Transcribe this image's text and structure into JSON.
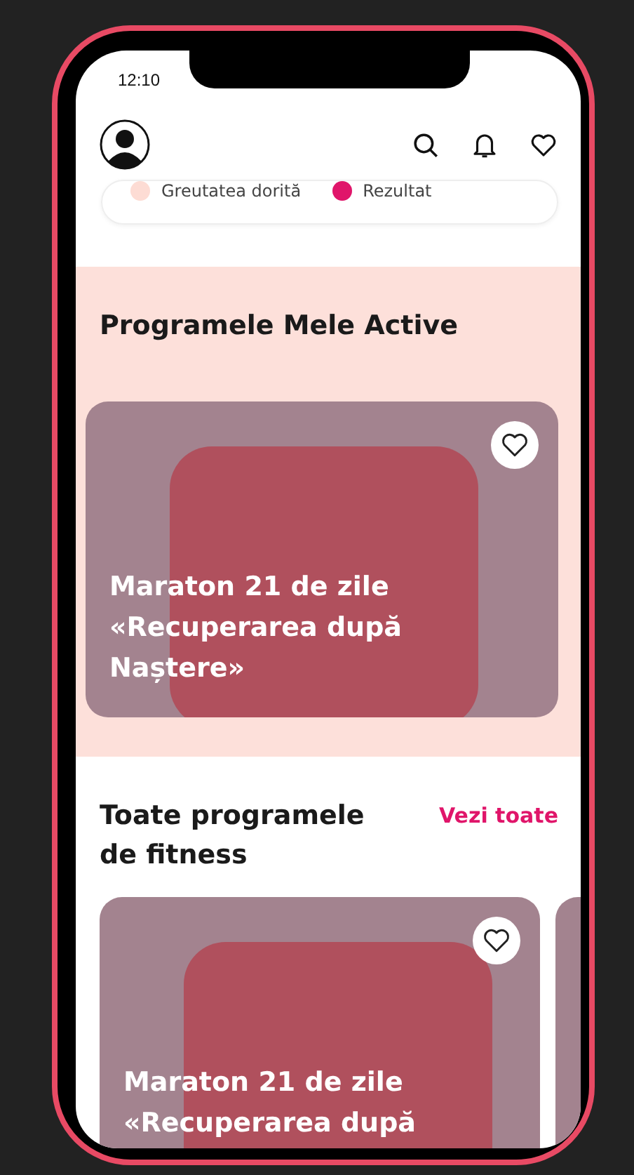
{
  "status_bar": {
    "time": "12:10"
  },
  "legend": [
    {
      "label": "Greutatea dorită",
      "color": "#fddcd4"
    },
    {
      "label": "Rezultat",
      "color": "#e0156a"
    }
  ],
  "active_section": {
    "title": "Programele Mele Active",
    "programs": [
      {
        "kind": "full",
        "title": "Maraton 21 de zile «Recuperarea după Naștere»",
        "favorite": false
      }
    ]
  },
  "all_section": {
    "title": "Toate programele de fitness",
    "link": "Vezi toate",
    "programs": [
      {
        "kind": "full",
        "title": "Maraton 21 de zile «Recuperarea după",
        "favorite": false
      },
      {
        "kind": "peek"
      }
    ]
  }
}
